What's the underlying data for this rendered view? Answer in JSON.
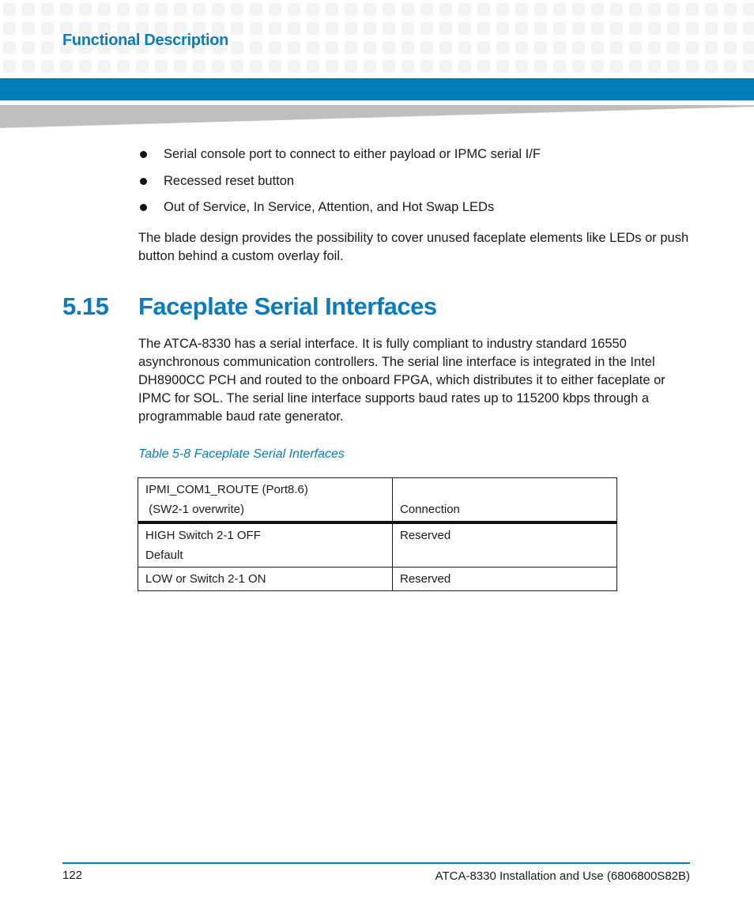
{
  "header": {
    "section_title": "Functional Description",
    "accent_color": "#007dbd"
  },
  "bullets": [
    "Serial console port to connect to either payload or IPMC serial I/F",
    "Recessed reset button",
    "Out of Service, In Service, Attention, and Hot Swap LEDs"
  ],
  "paragraph_1": "The blade design provides the possibility to cover unused faceplate elements like LEDs or push button behind a custom overlay foil.",
  "section": {
    "number": "5.15",
    "title": "Faceplate Serial Interfaces"
  },
  "paragraph_2": "The ATCA-8330 has a serial interface. It is fully compliant to industry standard 16550 asynchronous communication controllers. The serial line interface is integrated in the Intel DH8900CC PCH and routed to the onboard FPGA, which distributes it to either faceplate or IPMC for SOL. The serial line interface supports baud rates up to 115200 kbps through a programmable baud rate generator.",
  "table": {
    "caption": "Table 5-8 Faceplate Serial Interfaces",
    "header": {
      "col1_line1": "IPMI_COM1_ROUTE (Port8.6)",
      "col1_line2": " (SW2-1 overwrite)",
      "col2": "Connection"
    },
    "rows": [
      {
        "col1_line1": "HIGH Switch 2-1 OFF",
        "col1_line2": "Default",
        "col2": "Reserved"
      },
      {
        "col1_line1": "LOW or Switch 2-1 ON",
        "col1_line2": "",
        "col2": "Reserved"
      }
    ]
  },
  "footer": {
    "page_number": "122",
    "document_reference": "ATCA-8330 Installation and Use (6806800S82B)"
  }
}
